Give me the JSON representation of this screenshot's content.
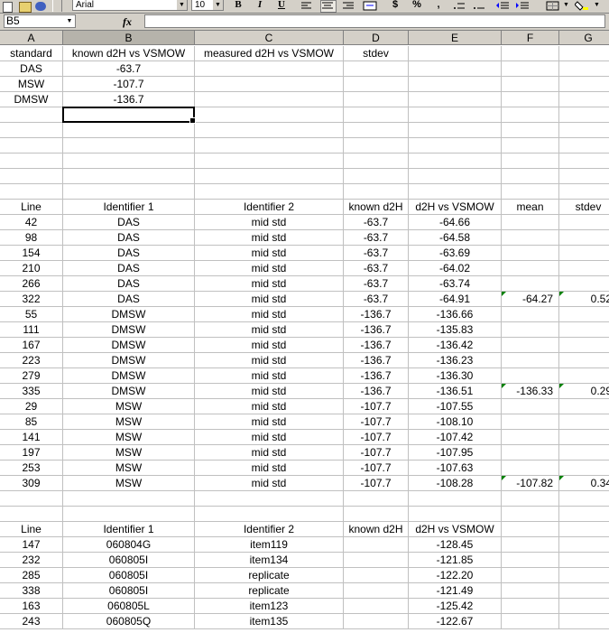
{
  "toolbar": {
    "font_name": "Arial",
    "font_size": "10",
    "bold_label": "B",
    "italic_label": "I",
    "underline_label": "U",
    "currency_label": "$",
    "percent_label": "%",
    "comma_label": ","
  },
  "formula_bar": {
    "name_box": "B5",
    "fx_label": "fx",
    "formula": ""
  },
  "columns": [
    "A",
    "B",
    "C",
    "D",
    "E",
    "F",
    "G"
  ],
  "selected_column": "B",
  "rows": [
    [
      "standard",
      "known d2H vs VSMOW",
      "measured d2H vs VSMOW",
      "stdev",
      "",
      "",
      ""
    ],
    [
      "DAS",
      "-63.7",
      "",
      "",
      "",
      "",
      ""
    ],
    [
      "MSW",
      "-107.7",
      "",
      "",
      "",
      "",
      ""
    ],
    [
      "DMSW",
      "-136.7",
      "",
      "",
      "",
      "",
      ""
    ],
    [
      "",
      "",
      "",
      "",
      "",
      "",
      ""
    ],
    [
      "",
      "",
      "",
      "",
      "",
      "",
      ""
    ],
    [
      "",
      "",
      "",
      "",
      "",
      "",
      ""
    ],
    [
      "",
      "",
      "",
      "",
      "",
      "",
      ""
    ],
    [
      "",
      "",
      "",
      "",
      "",
      "",
      ""
    ],
    [
      "",
      "",
      "",
      "",
      "",
      "",
      ""
    ],
    [
      "Line",
      "Identifier 1",
      "Identifier 2",
      "known d2H",
      "d2H vs VSMOW",
      "mean",
      "stdev"
    ],
    [
      "42",
      "DAS",
      "mid std",
      "-63.7",
      "-64.66",
      "",
      ""
    ],
    [
      "98",
      "DAS",
      "mid std",
      "-63.7",
      "-64.58",
      "",
      ""
    ],
    [
      "154",
      "DAS",
      "mid std",
      "-63.7",
      "-63.69",
      "",
      ""
    ],
    [
      "210",
      "DAS",
      "mid std",
      "-63.7",
      "-64.02",
      "",
      ""
    ],
    [
      "266",
      "DAS",
      "mid std",
      "-63.7",
      "-63.74",
      "",
      ""
    ],
    [
      "322",
      "DAS",
      "mid std",
      "-63.7",
      "-64.91",
      "-64.27",
      "0.52"
    ],
    [
      "55",
      "DMSW",
      "mid std",
      "-136.7",
      "-136.66",
      "",
      ""
    ],
    [
      "111",
      "DMSW",
      "mid std",
      "-136.7",
      "-135.83",
      "",
      ""
    ],
    [
      "167",
      "DMSW",
      "mid std",
      "-136.7",
      "-136.42",
      "",
      ""
    ],
    [
      "223",
      "DMSW",
      "mid std",
      "-136.7",
      "-136.23",
      "",
      ""
    ],
    [
      "279",
      "DMSW",
      "mid std",
      "-136.7",
      "-136.30",
      "",
      ""
    ],
    [
      "335",
      "DMSW",
      "mid std",
      "-136.7",
      "-136.51",
      "-136.33",
      "0.29"
    ],
    [
      "29",
      "MSW",
      "mid std",
      "-107.7",
      "-107.55",
      "",
      ""
    ],
    [
      "85",
      "MSW",
      "mid std",
      "-107.7",
      "-108.10",
      "",
      ""
    ],
    [
      "141",
      "MSW",
      "mid std",
      "-107.7",
      "-107.42",
      "",
      ""
    ],
    [
      "197",
      "MSW",
      "mid std",
      "-107.7",
      "-107.95",
      "",
      ""
    ],
    [
      "253",
      "MSW",
      "mid std",
      "-107.7",
      "-107.63",
      "",
      ""
    ],
    [
      "309",
      "MSW",
      "mid std",
      "-107.7",
      "-108.28",
      "-107.82",
      "0.34"
    ],
    [
      "",
      "",
      "",
      "",
      "",
      "",
      ""
    ],
    [
      "",
      "",
      "",
      "",
      "",
      "",
      ""
    ],
    [
      "Line",
      "Identifier 1",
      "Identifier 2",
      "known d2H",
      "d2H vs VSMOW",
      "",
      ""
    ],
    [
      "147",
      "060804G",
      "item119",
      "",
      "-128.45",
      "",
      ""
    ],
    [
      "232",
      "060805I",
      "item134",
      "",
      "-121.85",
      "",
      ""
    ],
    [
      "285",
      "060805I",
      "replicate",
      "",
      "-122.20",
      "",
      ""
    ],
    [
      "338",
      "060805I",
      "replicate",
      "",
      "-121.49",
      "",
      ""
    ],
    [
      "163",
      "060805L",
      "item123",
      "",
      "-125.42",
      "",
      ""
    ],
    [
      "243",
      "060805Q",
      "item135",
      "",
      "-122.67",
      "",
      ""
    ]
  ]
}
